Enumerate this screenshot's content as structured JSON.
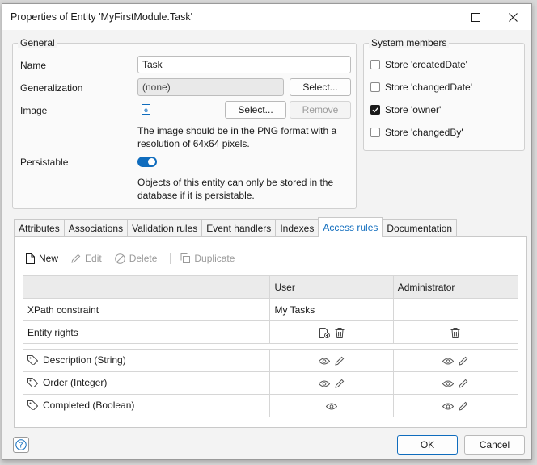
{
  "window": {
    "title": "Properties of Entity 'MyFirstModule.Task'"
  },
  "general": {
    "legend": "General",
    "name_label": "Name",
    "name_value": "Task",
    "generalization_label": "Generalization",
    "generalization_value": "(none)",
    "generalization_select": "Select...",
    "image_label": "Image",
    "image_select": "Select...",
    "image_remove": "Remove",
    "image_hint_1": "The image should be in the PNG format with a",
    "image_hint_2": "resolution of 64x64 pixels.",
    "persistable_label": "Persistable",
    "persistable_on": true,
    "persistable_hint_1": "Objects of this entity can only be stored in the",
    "persistable_hint_2": "database if it is persistable."
  },
  "system_members": {
    "legend": "System members",
    "items": [
      {
        "label": "Store 'createdDate'",
        "checked": false
      },
      {
        "label": "Store 'changedDate'",
        "checked": false
      },
      {
        "label": "Store 'owner'",
        "checked": true
      },
      {
        "label": "Store 'changedBy'",
        "checked": false
      }
    ]
  },
  "tabs": [
    {
      "label": "Attributes"
    },
    {
      "label": "Associations"
    },
    {
      "label": "Validation rules"
    },
    {
      "label": "Event handlers"
    },
    {
      "label": "Indexes"
    },
    {
      "label": "Access rules",
      "active": true
    },
    {
      "label": "Documentation"
    }
  ],
  "toolbar": {
    "new": "New",
    "edit": "Edit",
    "delete": "Delete",
    "duplicate": "Duplicate"
  },
  "access_table": {
    "headers": [
      "",
      "User",
      "Administrator"
    ],
    "rows": [
      {
        "label": "XPath constraint",
        "user": "My Tasks",
        "admin": ""
      },
      {
        "label": "Entity rights",
        "user": "",
        "admin": ""
      }
    ],
    "attributes": [
      {
        "label": "Description (String)"
      },
      {
        "label": "Order (Integer)"
      },
      {
        "label": "Completed (Boolean)"
      }
    ]
  },
  "footer": {
    "ok": "OK",
    "cancel": "Cancel"
  },
  "colors": {
    "accent": "#0f6cbd"
  }
}
